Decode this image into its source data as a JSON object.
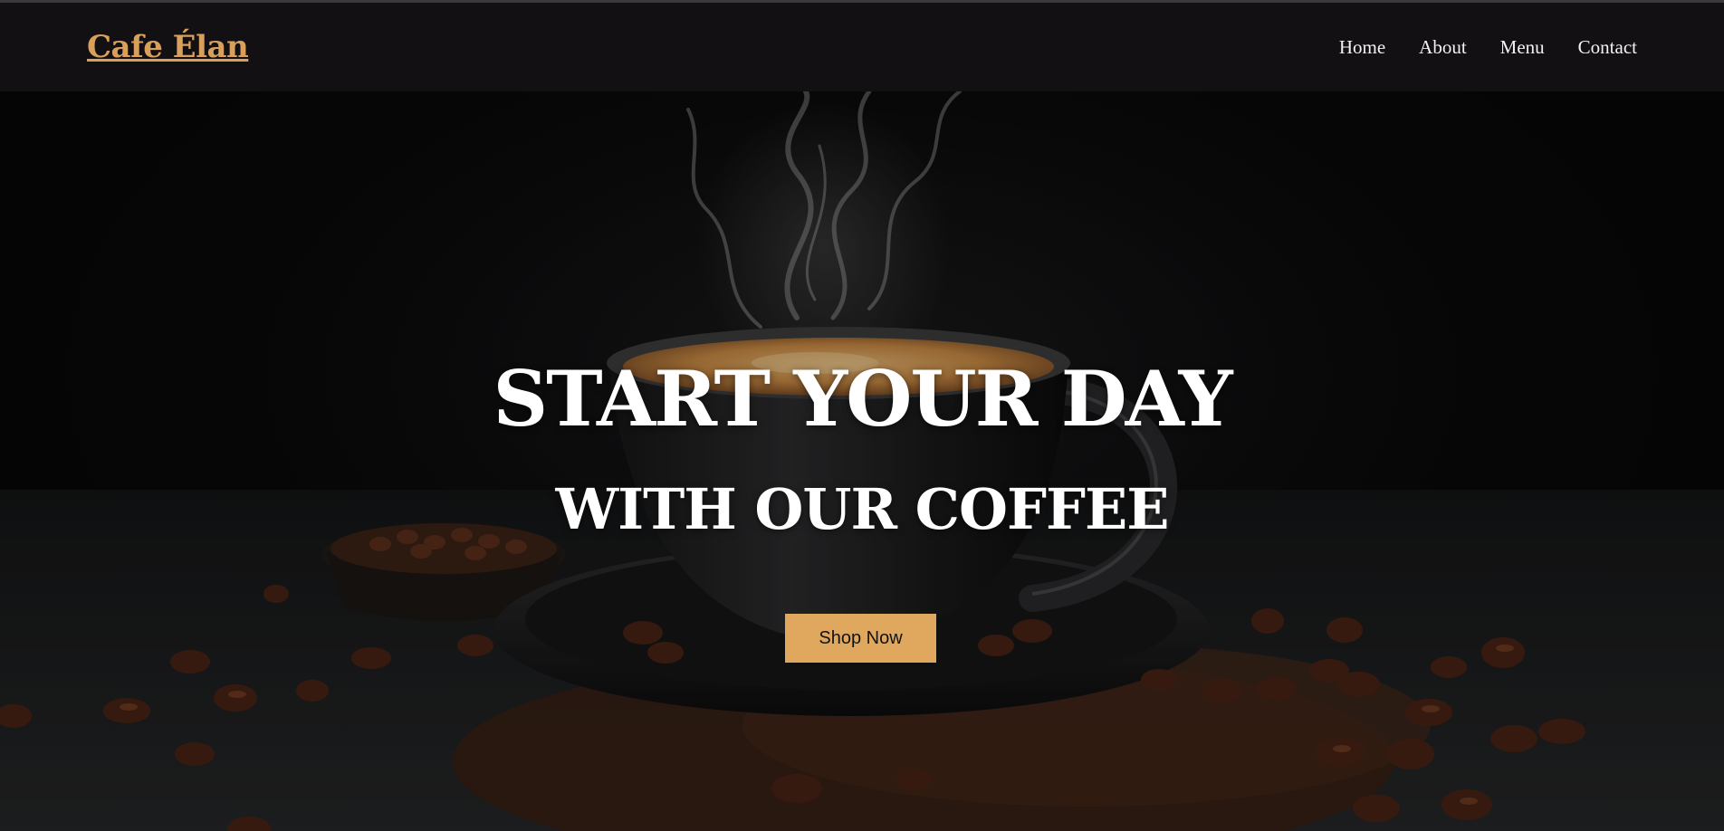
{
  "brand": {
    "name": "Cafe Élan",
    "color": "#d9a05b"
  },
  "nav": {
    "items": [
      {
        "label": "Home"
      },
      {
        "label": "About"
      },
      {
        "label": "Menu"
      },
      {
        "label": "Contact"
      }
    ]
  },
  "hero": {
    "title": "START YOUR DAY",
    "subtitle": "WITH OUR COFFEE",
    "cta_label": "Shop Now",
    "cta_color": "#e0a75e"
  }
}
